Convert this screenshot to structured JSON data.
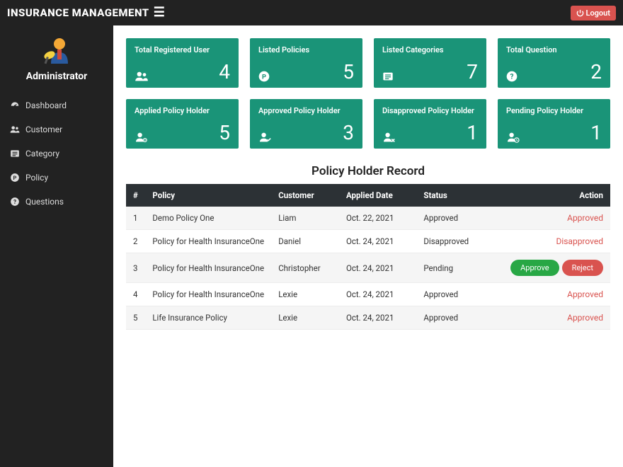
{
  "header": {
    "brand": "INSURANCE MANAGEMENT",
    "logout_label": "Logout"
  },
  "sidebar": {
    "user_role": "Administrator",
    "items": [
      {
        "label": "Dashboard",
        "icon": "dashboard-icon"
      },
      {
        "label": "Customer",
        "icon": "users-icon"
      },
      {
        "label": "Category",
        "icon": "list-icon"
      },
      {
        "label": "Policy",
        "icon": "p-circle-icon"
      },
      {
        "label": "Questions",
        "icon": "question-icon"
      }
    ]
  },
  "cards": [
    {
      "title": "Total Registered User",
      "value": "4",
      "icon": "users-icon"
    },
    {
      "title": "Listed Policies",
      "value": "5",
      "icon": "p-circle-icon"
    },
    {
      "title": "Listed Categories",
      "value": "7",
      "icon": "list-icon"
    },
    {
      "title": "Total Question",
      "value": "2",
      "icon": "question-icon"
    },
    {
      "title": "Applied Policy Holder",
      "value": "5",
      "icon": "user-gear-icon"
    },
    {
      "title": "Approved Policy Holder",
      "value": "3",
      "icon": "user-check-icon"
    },
    {
      "title": "Disapproved Policy Holder",
      "value": "1",
      "icon": "user-x-icon"
    },
    {
      "title": "Pending Policy Holder",
      "value": "1",
      "icon": "user-clock-icon"
    }
  ],
  "table": {
    "title": "Policy Holder Record",
    "columns": [
      "#",
      "Policy",
      "Customer",
      "Applied Date",
      "Status",
      "Action"
    ],
    "rows": [
      {
        "idx": "1",
        "policy": "Demo Policy One",
        "customer": "Liam",
        "date": "Oct. 22, 2021",
        "status": "Approved",
        "action_type": "text",
        "action_label": "Approved"
      },
      {
        "idx": "2",
        "policy": "Policy for Health InsuranceOne",
        "customer": "Daniel",
        "date": "Oct. 24, 2021",
        "status": "Disapproved",
        "action_type": "text",
        "action_label": "Disapproved"
      },
      {
        "idx": "3",
        "policy": "Policy for Health InsuranceOne",
        "customer": "Christopher",
        "date": "Oct. 24, 2021",
        "status": "Pending",
        "action_type": "buttons",
        "approve_label": "Approve",
        "reject_label": "Reject"
      },
      {
        "idx": "4",
        "policy": "Policy for Health InsuranceOne",
        "customer": "Lexie",
        "date": "Oct. 24, 2021",
        "status": "Approved",
        "action_type": "text",
        "action_label": "Approved"
      },
      {
        "idx": "5",
        "policy": "Life Insurance Policy",
        "customer": "Lexie",
        "date": "Oct. 24, 2021",
        "status": "Approved",
        "action_type": "text",
        "action_label": "Approved"
      }
    ]
  },
  "colors": {
    "card_bg": "#1a9478",
    "danger": "#d9534f",
    "success": "#28a745",
    "dark": "#222"
  }
}
